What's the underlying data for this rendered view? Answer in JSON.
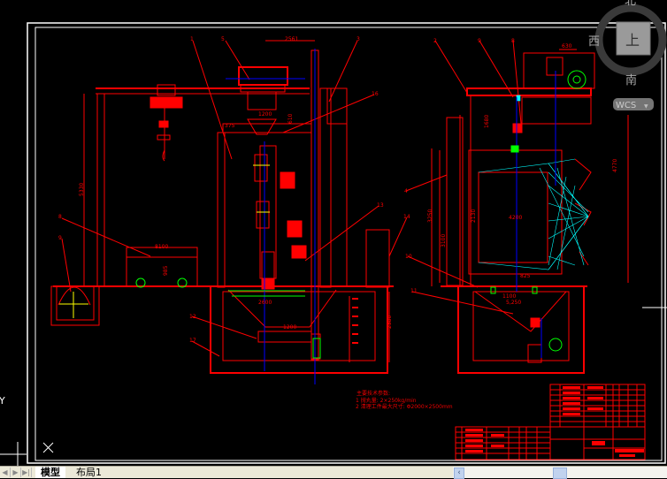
{
  "viewcube": {
    "north": "北",
    "west": "西",
    "south": "南",
    "face": "上",
    "ucs": "WCS",
    "ucs_arrow": "▼"
  },
  "ucs_icon": {
    "y_label": "Y"
  },
  "drawing": {
    "left_view": {
      "balloons": [
        "1",
        "5",
        "3",
        "16",
        "8",
        "9",
        "13",
        "14",
        "12",
        "17"
      ],
      "dims": [
        "2561",
        "1200",
        "610",
        "5330",
        "8100",
        "985",
        "2600",
        "1200",
        "2380",
        "375"
      ]
    },
    "right_view": {
      "balloons": [
        "2",
        "9",
        "8",
        "4",
        "10",
        "11"
      ],
      "dims": [
        "630",
        "1680",
        "3250",
        "3100",
        "2130",
        "4200",
        "4770",
        "825",
        "1100",
        "5,250"
      ]
    },
    "notes": {
      "title": "主要技术参数:",
      "line1": "1 抛丸量: 2×250kg/min",
      "line2": "2 清理工件最大尺寸: Φ2000×2500mm"
    }
  },
  "colors": {
    "line": "#ff0000",
    "center": "#0000ff",
    "hatch_fill": "#00ffff",
    "green": "#00ff00",
    "yellow": "#ffff00",
    "frame": "#ffffff"
  },
  "statusbar": {
    "nav": [
      "◀",
      "▶",
      "▶|"
    ],
    "tabs": [
      {
        "label": "模型",
        "active": true
      },
      {
        "label": "布局1",
        "active": false
      }
    ],
    "scroll_left": "‹"
  }
}
